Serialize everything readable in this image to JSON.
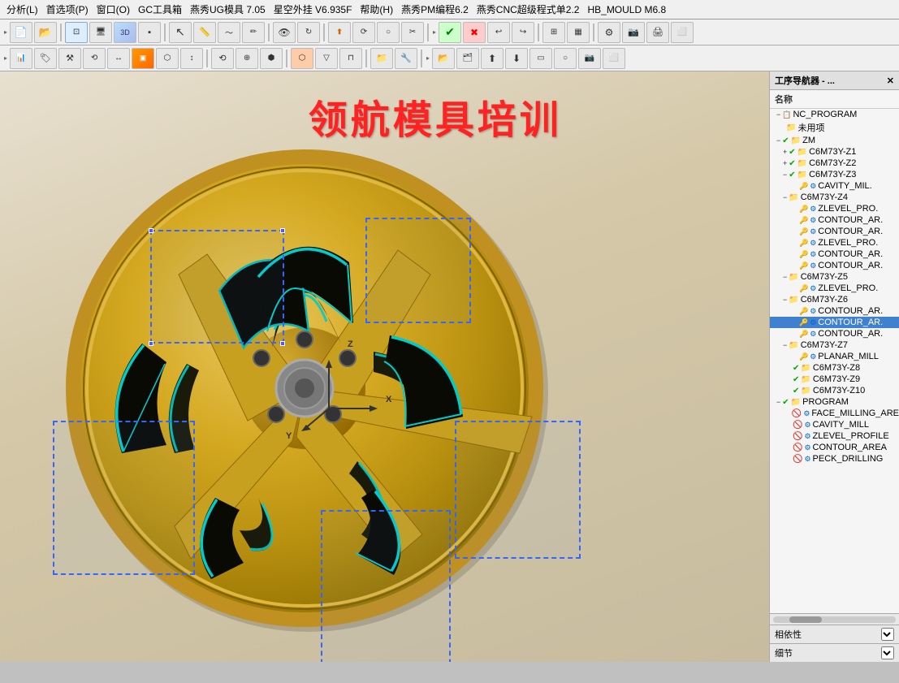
{
  "menubar": {
    "items": [
      "分析(L)",
      "首选项(P)",
      "窗口(O)",
      "GC工具箱",
      "燕秀UG模具 7.05",
      "星空外挂 V6.935F",
      "帮助(H)",
      "燕秀PM编程6.2",
      "燕秀CNC超级程式单2.2",
      "HB_MOULD M6.8"
    ]
  },
  "watermark": "领航模具培训",
  "prog_nav": {
    "title": "工序导航器 - ...",
    "col_label": "名称",
    "root": "NC_PROGRAM",
    "items": [
      {
        "id": "unused",
        "label": "未用项",
        "indent": 1,
        "icon": "folder",
        "expand": ""
      },
      {
        "id": "zm",
        "label": "ZM",
        "indent": 1,
        "icon": "folder-check",
        "expand": "−"
      },
      {
        "id": "z1",
        "label": "C6M73Y-Z1",
        "indent": 2,
        "icon": "folder-check",
        "expand": "+"
      },
      {
        "id": "z2",
        "label": "C6M73Y-Z2",
        "indent": 2,
        "icon": "folder-check",
        "expand": "+"
      },
      {
        "id": "z3",
        "label": "C6M73Y-Z3",
        "indent": 2,
        "icon": "folder-check",
        "expand": "−"
      },
      {
        "id": "cavity_mil",
        "label": "CAVITY_MIL.",
        "indent": 3,
        "icon": "op-check",
        "expand": ""
      },
      {
        "id": "z4",
        "label": "C6M73Y-Z4",
        "indent": 2,
        "icon": "folder",
        "expand": "−"
      },
      {
        "id": "zlevel_pro1",
        "label": "ZLEVEL_PRO.",
        "indent": 3,
        "icon": "op",
        "expand": ""
      },
      {
        "id": "contour_ar1",
        "label": "CONTOUR_AR.",
        "indent": 3,
        "icon": "op",
        "expand": ""
      },
      {
        "id": "contour_ar2",
        "label": "CONTOUR_AR.",
        "indent": 3,
        "icon": "op",
        "expand": ""
      },
      {
        "id": "zlevel_pro2",
        "label": "ZLEVEL_PRO.",
        "indent": 3,
        "icon": "op",
        "expand": ""
      },
      {
        "id": "contour_ar3",
        "label": "CONTOUR_AR.",
        "indent": 3,
        "icon": "op",
        "expand": ""
      },
      {
        "id": "contour_ar4",
        "label": "CONTOUR_AR.",
        "indent": 3,
        "icon": "op",
        "expand": ""
      },
      {
        "id": "z5",
        "label": "C6M73Y-Z5",
        "indent": 2,
        "icon": "folder",
        "expand": "−"
      },
      {
        "id": "zlevel_pro3",
        "label": "ZLEVEL_PRO.",
        "indent": 3,
        "icon": "op",
        "expand": ""
      },
      {
        "id": "z6",
        "label": "C6M73Y-Z6",
        "indent": 2,
        "icon": "folder",
        "expand": "−"
      },
      {
        "id": "contour_ar5",
        "label": "CONTOUR_AR.",
        "indent": 3,
        "icon": "op",
        "expand": ""
      },
      {
        "id": "contour_ar6",
        "label": "CONTOUR_AR.",
        "indent": 3,
        "icon": "op-selected",
        "expand": ""
      },
      {
        "id": "contour_ar7",
        "label": "CONTOUR_AR.",
        "indent": 3,
        "icon": "op",
        "expand": ""
      },
      {
        "id": "z7",
        "label": "C6M73Y-Z7",
        "indent": 2,
        "icon": "folder",
        "expand": "−"
      },
      {
        "id": "planar_mill",
        "label": "PLANAR_MILL",
        "indent": 3,
        "icon": "op",
        "expand": ""
      },
      {
        "id": "z8",
        "label": "C6M73Y-Z8",
        "indent": 2,
        "icon": "folder-check",
        "expand": ""
      },
      {
        "id": "z9",
        "label": "C6M73Y-Z9",
        "indent": 2,
        "icon": "folder-check",
        "expand": ""
      },
      {
        "id": "z10",
        "label": "C6M73Y-Z10",
        "indent": 2,
        "icon": "folder-check",
        "expand": ""
      },
      {
        "id": "program",
        "label": "PROGRAM",
        "indent": 1,
        "icon": "folder-check",
        "expand": "−"
      },
      {
        "id": "face_milling",
        "label": "FACE_MILLING_ARE",
        "indent": 2,
        "icon": "op-err",
        "expand": ""
      },
      {
        "id": "cavity_mill2",
        "label": "CAVITY_MILL",
        "indent": 2,
        "icon": "op-err",
        "expand": ""
      },
      {
        "id": "zlevel_profile",
        "label": "ZLEVEL_PROFILE",
        "indent": 2,
        "icon": "op-err",
        "expand": ""
      },
      {
        "id": "contour_area",
        "label": "CONTOUR_AREA",
        "indent": 2,
        "icon": "op-err",
        "expand": ""
      },
      {
        "id": "peck_drilling",
        "label": "PECK_DRILLING",
        "indent": 2,
        "icon": "op-err",
        "expand": ""
      }
    ]
  },
  "bottom": {
    "dependency_label": "相依性",
    "details_label": "细节"
  },
  "axes": {
    "x": "X",
    "y": "Y",
    "z": "Z"
  }
}
